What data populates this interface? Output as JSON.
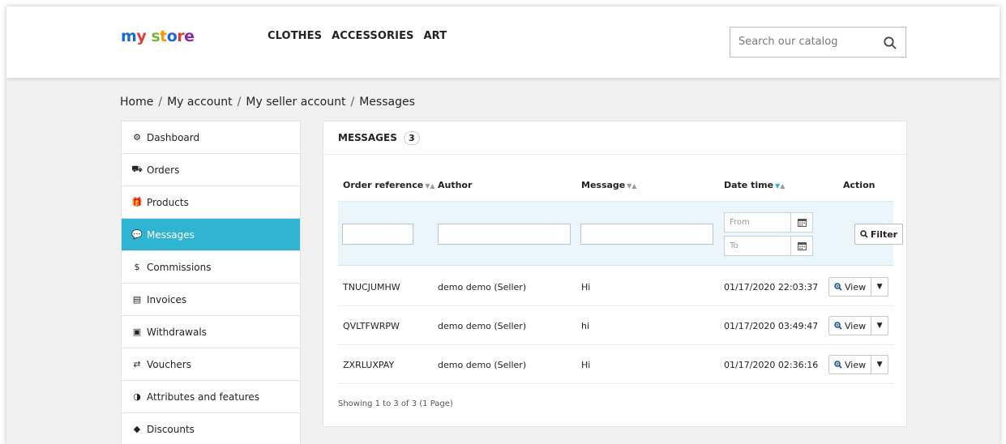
{
  "header": {
    "logo_parts": [
      "m",
      "y",
      " ",
      "s",
      "t",
      "o",
      "r",
      "e"
    ],
    "logo_colors": [
      "#1a6bd6",
      "#e53935",
      "#ffffff",
      "#7cb342",
      "#ff9800",
      "#1a6bd6",
      "#e53935",
      "#8e24aa"
    ],
    "nav": [
      "CLOTHES",
      "ACCESSORIES",
      "ART"
    ],
    "search_placeholder": "Search our catalog",
    "search_icon": "search-icon"
  },
  "breadcrumb": [
    "Home",
    "My account",
    "My seller account",
    "Messages"
  ],
  "sidebar": {
    "items": [
      {
        "label": "Dashboard",
        "icon": "dashboard-icon",
        "glyph": "⚙"
      },
      {
        "label": "Orders",
        "icon": "basket-icon",
        "glyph": "⛟"
      },
      {
        "label": "Products",
        "icon": "gift-icon",
        "glyph": "🎁"
      },
      {
        "label": "Messages",
        "icon": "chat-icon",
        "glyph": "💬",
        "active": true
      },
      {
        "label": "Commissions",
        "icon": "dollar-icon",
        "glyph": "$"
      },
      {
        "label": "Invoices",
        "icon": "invoice-icon",
        "glyph": "▤"
      },
      {
        "label": "Withdrawals",
        "icon": "money-icon",
        "glyph": "▣"
      },
      {
        "label": "Vouchers",
        "icon": "exchange-icon",
        "glyph": "⇄"
      },
      {
        "label": "Attributes and features",
        "icon": "adjust-icon",
        "glyph": "◑"
      },
      {
        "label": "Discounts",
        "icon": "tag-icon",
        "glyph": "◆"
      }
    ],
    "accent": "#2fb5d2"
  },
  "messages": {
    "title": "MESSAGES",
    "count": "3",
    "columns": [
      "Order reference",
      "Author",
      "Message",
      "Date time",
      "Action"
    ],
    "filter": {
      "from_placeholder": "From",
      "to_placeholder": "To",
      "button_label": "Filter"
    },
    "rows": [
      {
        "ref": "TNUCJUMHW",
        "author": "demo demo (Seller)",
        "message": "Hi",
        "date": "01/17/2020 22:03:37",
        "action": "View"
      },
      {
        "ref": "QVLTFWRPW",
        "author": "demo demo (Seller)",
        "message": "hi",
        "date": "01/17/2020 03:49:47",
        "action": "View"
      },
      {
        "ref": "ZXRLUXPAY",
        "author": "demo demo (Seller)",
        "message": "Hi",
        "date": "01/17/2020 02:36:16",
        "action": "View"
      }
    ],
    "showing": "Showing 1 to 3 of 3 (1 Page)"
  }
}
